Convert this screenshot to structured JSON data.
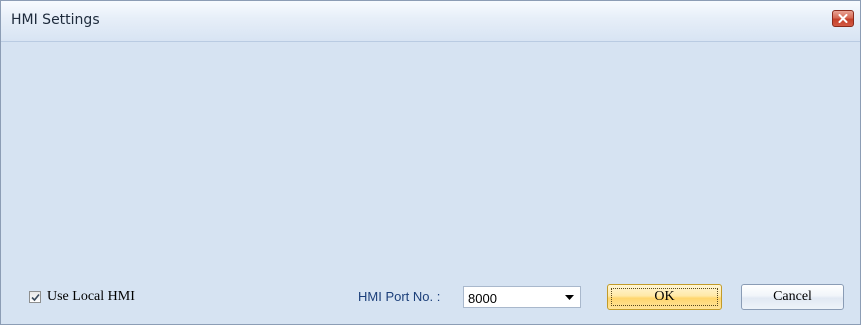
{
  "window": {
    "title": "HMI Settings"
  },
  "options": {
    "use_local_hmi_label": "Use Local HMI",
    "use_local_hmi_checked": true
  },
  "port": {
    "label": "HMI Port No. :",
    "value": "8000"
  },
  "buttons": {
    "ok_label": "OK",
    "cancel_label": "Cancel"
  },
  "colors": {
    "window_bg": "#d6e3f2",
    "close_button": "#c4402a",
    "ok_button": "#ffd66e",
    "port_label_text": "#1c3f7a"
  }
}
